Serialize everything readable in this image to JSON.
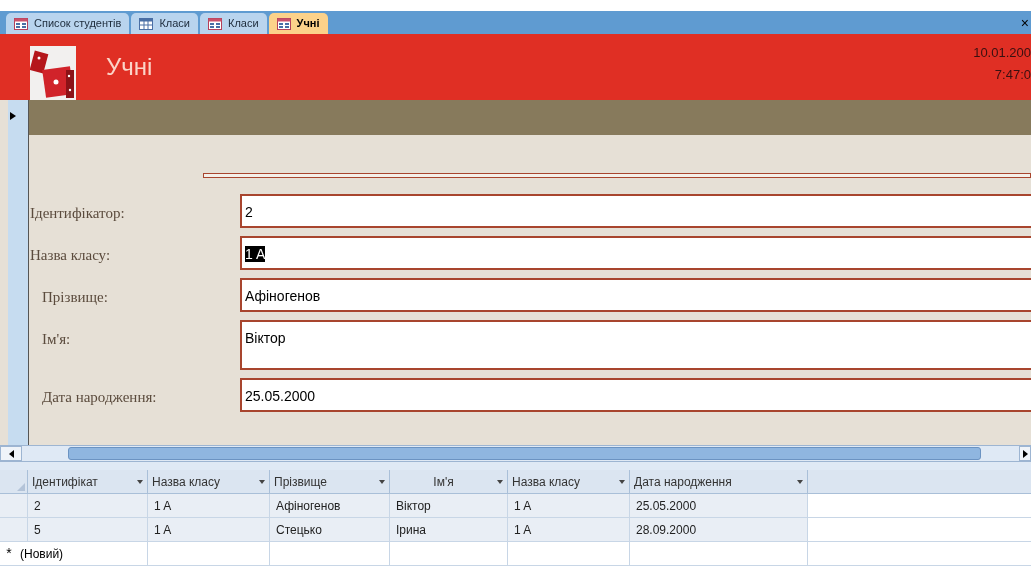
{
  "tabs": [
    {
      "label": "Список студентів",
      "kind": "form",
      "selected": false
    },
    {
      "label": "Класи",
      "kind": "table",
      "selected": false
    },
    {
      "label": "Класи",
      "kind": "form",
      "selected": false
    },
    {
      "label": "Учні",
      "kind": "form",
      "selected": true
    }
  ],
  "close_glyph": "×",
  "header": {
    "title": "Учні",
    "date": "10.01.200",
    "time": "7:47:0"
  },
  "form_fields": [
    {
      "label": "Ідентифікатор:",
      "value": "2",
      "kind": "text",
      "selected": false
    },
    {
      "label": "Назва класу:",
      "value": "1 A",
      "kind": "text",
      "selected": true
    },
    {
      "label": "Прізвище:",
      "value": "Афіногенов",
      "kind": "text",
      "selected": false
    },
    {
      "label": "Ім'я:",
      "value": "Віктор",
      "kind": "memo",
      "selected": false
    },
    {
      "label": "Дата народження:",
      "value": "25.05.2000",
      "kind": "text",
      "selected": false
    }
  ],
  "datasheet": {
    "columns": [
      "Ідентифікат",
      "Назва класу",
      "Прізвище",
      "Ім'я",
      "Назва класу",
      "Дата народження"
    ],
    "rows": [
      [
        "2",
        "1 A",
        "Афіногенов",
        "Віктор",
        "1 A",
        "25.05.2000"
      ],
      [
        "5",
        "1 A",
        "Стецько",
        "Ірина",
        "1 A",
        "28.09.2000"
      ]
    ],
    "new_row": {
      "marker": "*",
      "label": "(Новий)"
    }
  }
}
